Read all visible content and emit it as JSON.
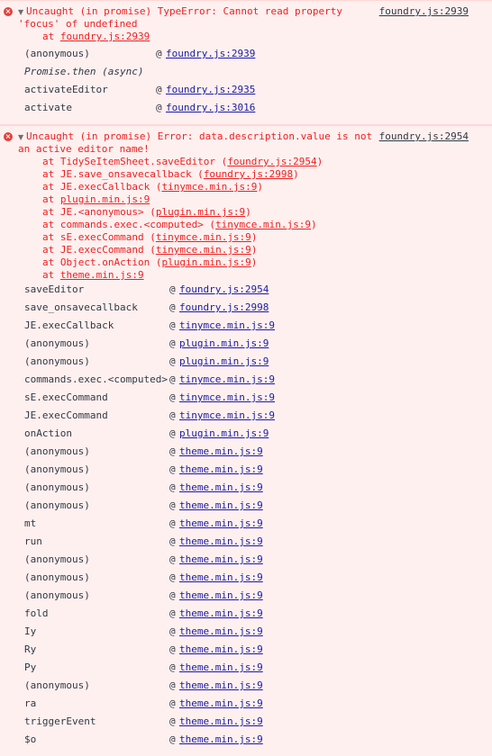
{
  "errors": [
    {
      "icon": "error-icon",
      "message_lines": [
        "Uncaught (in promise) TypeError: Cannot read property",
        "'focus' of undefined"
      ],
      "source": "foundry.js:2939",
      "stack": [
        {
          "prefix": "at ",
          "loc": "foundry.js:2939",
          "paren": false,
          "fn": ""
        }
      ],
      "frames": [
        {
          "fn": "(anonymous)",
          "loc": "foundry.js:2939"
        },
        {
          "async": "Promise.then (async)"
        },
        {
          "fn": "activateEditor",
          "loc": "foundry.js:2935"
        },
        {
          "fn": "activate",
          "loc": "foundry.js:3016"
        }
      ]
    },
    {
      "icon": "error-icon",
      "message_lines": [
        "Uncaught (in promise) Error: data.description.value is not",
        "an active editor name!"
      ],
      "source": "foundry.js:2954",
      "stack": [
        {
          "fn": "TidySeItemSheet.saveEditor",
          "loc": "foundry.js:2954"
        },
        {
          "fn": "JE.save_onsavecallback",
          "loc": "foundry.js:2998"
        },
        {
          "fn": "JE.execCallback",
          "loc": "tinymce.min.js:9"
        },
        {
          "fn": "",
          "loc": "plugin.min.js:9"
        },
        {
          "fn": "JE.<anonymous>",
          "loc": "plugin.min.js:9"
        },
        {
          "fn": "commands.exec.<computed>",
          "loc": "tinymce.min.js:9"
        },
        {
          "fn": "sE.execCommand",
          "loc": "tinymce.min.js:9"
        },
        {
          "fn": "JE.execCommand",
          "loc": "tinymce.min.js:9"
        },
        {
          "fn": "Object.onAction",
          "loc": "plugin.min.js:9"
        },
        {
          "fn": "",
          "loc": "theme.min.js:9"
        }
      ],
      "frames": [
        {
          "fn": "saveEditor",
          "loc": "foundry.js:2954"
        },
        {
          "fn": "save_onsavecallback",
          "loc": "foundry.js:2998"
        },
        {
          "fn": "JE.execCallback",
          "loc": "tinymce.min.js:9"
        },
        {
          "fn": "(anonymous)",
          "loc": "plugin.min.js:9"
        },
        {
          "fn": "(anonymous)",
          "loc": "plugin.min.js:9"
        },
        {
          "fn": "commands.exec.<computed>",
          "loc": "tinymce.min.js:9"
        },
        {
          "fn": "sE.execCommand",
          "loc": "tinymce.min.js:9"
        },
        {
          "fn": "JE.execCommand",
          "loc": "tinymce.min.js:9"
        },
        {
          "fn": "onAction",
          "loc": "plugin.min.js:9"
        },
        {
          "fn": "(anonymous)",
          "loc": "theme.min.js:9"
        },
        {
          "fn": "(anonymous)",
          "loc": "theme.min.js:9"
        },
        {
          "fn": "(anonymous)",
          "loc": "theme.min.js:9"
        },
        {
          "fn": "(anonymous)",
          "loc": "theme.min.js:9"
        },
        {
          "fn": "mt",
          "loc": "theme.min.js:9"
        },
        {
          "fn": "run",
          "loc": "theme.min.js:9"
        },
        {
          "fn": "(anonymous)",
          "loc": "theme.min.js:9"
        },
        {
          "fn": "(anonymous)",
          "loc": "theme.min.js:9"
        },
        {
          "fn": "(anonymous)",
          "loc": "theme.min.js:9"
        },
        {
          "fn": "fold",
          "loc": "theme.min.js:9"
        },
        {
          "fn": "Iy",
          "loc": "theme.min.js:9"
        },
        {
          "fn": "Ry",
          "loc": "theme.min.js:9"
        },
        {
          "fn": "Py",
          "loc": "theme.min.js:9"
        },
        {
          "fn": "(anonymous)",
          "loc": "theme.min.js:9"
        },
        {
          "fn": "ra",
          "loc": "theme.min.js:9"
        },
        {
          "fn": "triggerEvent",
          "loc": "theme.min.js:9"
        },
        {
          "fn": "$o",
          "loc": "theme.min.js:9"
        }
      ]
    }
  ],
  "at_symbol": "@",
  "colors": {
    "error_text": "#f01e1e",
    "error_bg": "#fff0f0",
    "link": "#1a1aa6"
  }
}
